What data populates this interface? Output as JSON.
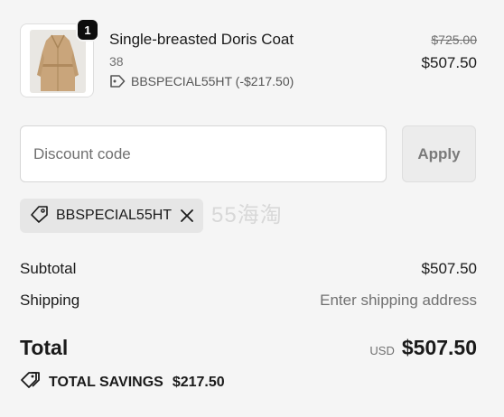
{
  "line_item": {
    "quantity": "1",
    "title": "Single-breasted Doris Coat",
    "variant": "38",
    "discount_text": "BBSPECIAL55HT (-$217.50)",
    "original_price": "$725.00",
    "price": "$507.50",
    "thumbnail_icon": "coat-product-image"
  },
  "discount": {
    "placeholder": "Discount code",
    "value": "",
    "apply_label": "Apply",
    "applied_code": "BBSPECIAL55HT"
  },
  "watermark": "55海淘",
  "summary": {
    "subtotal_label": "Subtotal",
    "subtotal_value": "$507.50",
    "shipping_label": "Shipping",
    "shipping_value": "Enter shipping address",
    "total_label": "Total",
    "currency": "USD",
    "total_value": "$507.50",
    "savings_label": "TOTAL SAVINGS",
    "savings_value": "$217.50"
  },
  "colors": {
    "background": "#f5f5f5",
    "badge": "#0d0d0d",
    "muted_text": "#707070",
    "coat": "#c9a57b"
  }
}
